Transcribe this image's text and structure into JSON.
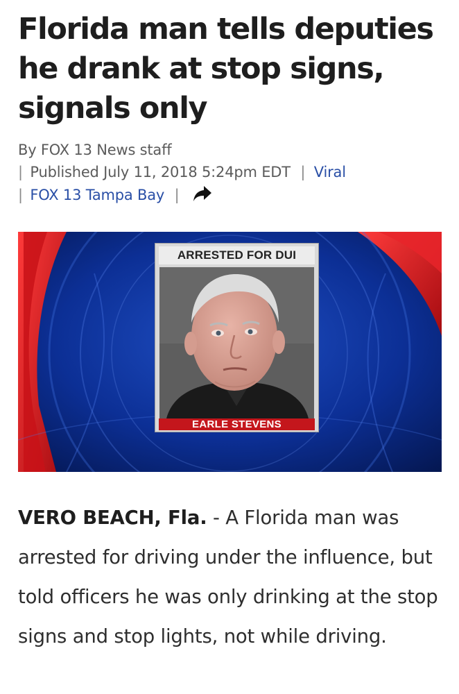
{
  "article": {
    "headline": "Florida man tells deputies he drank at stop signs, signals only",
    "byline": "By FOX 13 News staff",
    "published_label": "Published",
    "published_date": "July 11, 2018 5:24pm EDT",
    "category": "Viral",
    "source": "FOX 13 Tampa Bay",
    "pipe": "|",
    "share_icon": "share-arrow-icon",
    "image": {
      "top_label": "ARRESTED FOR DUI",
      "name_label": "EARLE STEVENS",
      "colors": {
        "background_blue": "#0a2a8a",
        "accent_red": "#d4141c",
        "label_red": "#c4161c"
      }
    },
    "dateline": "VERO BEACH, Fla.",
    "dateline_separator": " - ",
    "body": "A Florida man was arrested for driving under the influence, but told officers he was only drinking at the stop signs and stop lights, not while driving."
  },
  "colors": {
    "link": "#2a4fa6",
    "meta_text": "#5b5b5b",
    "headline": "#1e1e1e"
  }
}
